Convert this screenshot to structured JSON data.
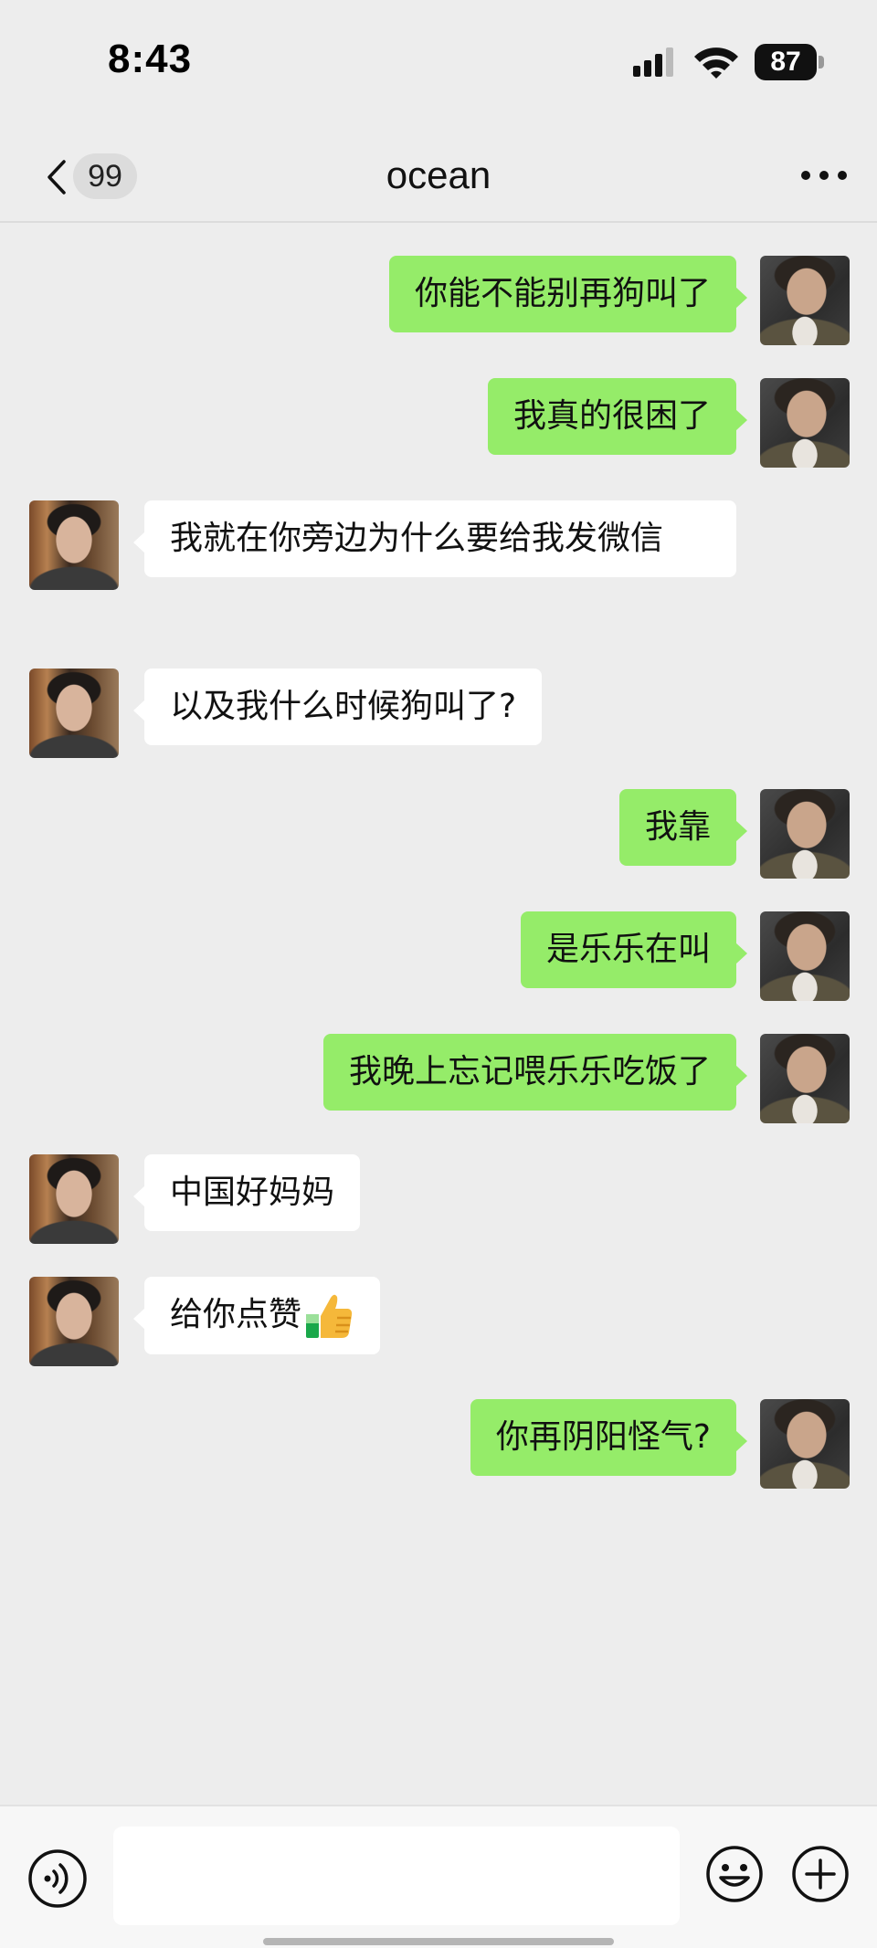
{
  "status_bar": {
    "time": "8:43",
    "battery_level": "87",
    "icons": [
      "signal-icon",
      "wifi-icon",
      "battery-icon"
    ]
  },
  "nav": {
    "unread_count": "99",
    "title": "ocean",
    "icons": [
      "chevron-left-icon",
      "more-dots-icon"
    ]
  },
  "messages": [
    {
      "sender": "me",
      "text": "你能不能别再狗叫了"
    },
    {
      "sender": "me",
      "text": "我真的很困了"
    },
    {
      "sender": "other",
      "text": "我就在你旁边为什么要给我发微信"
    },
    {
      "sender": "other",
      "text": "以及我什么时候狗叫了?"
    },
    {
      "sender": "me",
      "text": "我靠"
    },
    {
      "sender": "me",
      "text": "是乐乐在叫"
    },
    {
      "sender": "me",
      "text": "我晚上忘记喂乐乐吃饭了"
    },
    {
      "sender": "other",
      "text": "中国好妈妈"
    },
    {
      "sender": "other",
      "text": "给你点赞",
      "emoji": "thumbs-up-icon"
    },
    {
      "sender": "me",
      "text": "你再阴阳怪气?"
    }
  ],
  "input_bar": {
    "placeholder": "",
    "icons": [
      "voice-icon",
      "emoji-icon",
      "plus-icon"
    ]
  },
  "colors": {
    "background": "#ededed",
    "my_bubble": "#95ec69",
    "other_bubble": "#ffffff"
  }
}
